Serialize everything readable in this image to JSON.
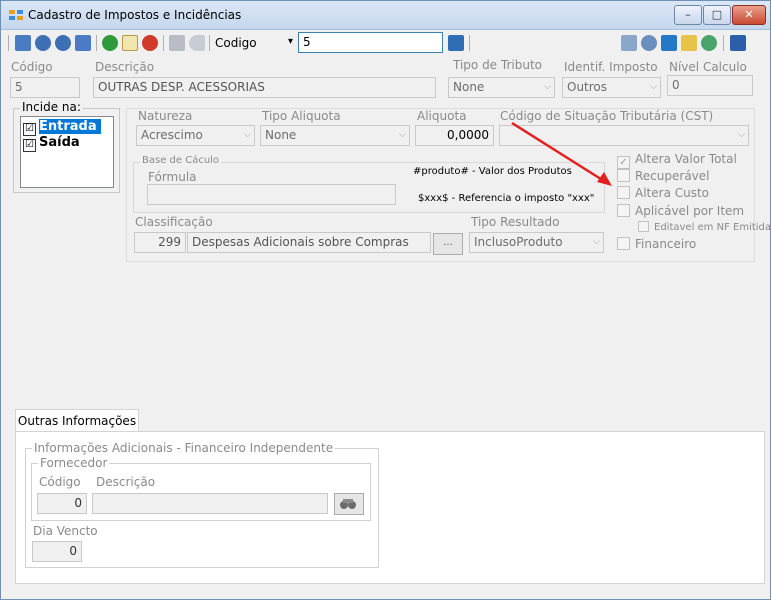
{
  "window": {
    "title": "Cadastro de Impostos e Incidências",
    "minimize": "–",
    "maximize": "□",
    "close": "✕"
  },
  "toolbar": {
    "search_field_label": "Codigo",
    "search_field_arrow": "▾",
    "search_value": "5"
  },
  "header": {
    "codigo_label": "Código",
    "codigo_value": "5",
    "descricao_label": "Descrição",
    "descricao_value": "OUTRAS DESP. ACESSORIAS",
    "tipo_tributo_label": "Tipo de Tributo",
    "tipo_tributo_value": "None",
    "identif_imposto_label": "Identif. Imposto",
    "identif_imposto_value": "Outros",
    "nivel_calculo_label": "Nível Calculo",
    "nivel_calculo_value": "0"
  },
  "incide": {
    "label": "Incide na:",
    "items": [
      {
        "label": "Entrada",
        "checked": "☑"
      },
      {
        "label": "Saída",
        "checked": "☑"
      }
    ]
  },
  "detail": {
    "natureza_label": "Natureza",
    "natureza_value": "Acrescimo",
    "tipo_aliquota_label": "Tipo Aliquota",
    "tipo_aliquota_value": "None",
    "aliquota_label": "Aliquota",
    "aliquota_value": "0,0000",
    "cst_label": "Código de Situação Tributária (CST)",
    "cst_value": "",
    "base_calculo_title": "Base de Cáculo",
    "formula_label": "Fórmula",
    "formula_value": "",
    "hint_produto": "#produto# - Valor dos Produtos",
    "hint_xxx": "$xxx$ - Referencia o imposto \"xxx\"",
    "classificacao_label": "Classificação",
    "classificacao_code": "299",
    "classificacao_desc": "Despesas Adicionais sobre Compras",
    "classificacao_btn": "...",
    "tipo_resultado_label": "Tipo Resultado",
    "tipo_resultado_value": "InclusoProduto"
  },
  "options": {
    "altera_valor_total": "Altera Valor Total",
    "recuperavel": "Recuperável",
    "altera_custo": "Altera Custo",
    "aplicavel_por_item": "Aplicável por Item",
    "editavel_nf": "Editavel em NF Emitida",
    "financeiro": "Financeiro"
  },
  "tabs": {
    "outras_info": "Outras Informações",
    "info_adicionais_title": "Informações Adicionais - Financeiro Independente",
    "fornecedor_title": "Fornecedor",
    "codigo_label": "Código",
    "codigo_value": "0",
    "descricao_label": "Descrição",
    "descricao_value": "",
    "dia_vencto_label": "Dia Vencto",
    "dia_vencto_value": "0"
  },
  "colors": {
    "accent": "#0078d7",
    "arrow": "#e32020"
  }
}
